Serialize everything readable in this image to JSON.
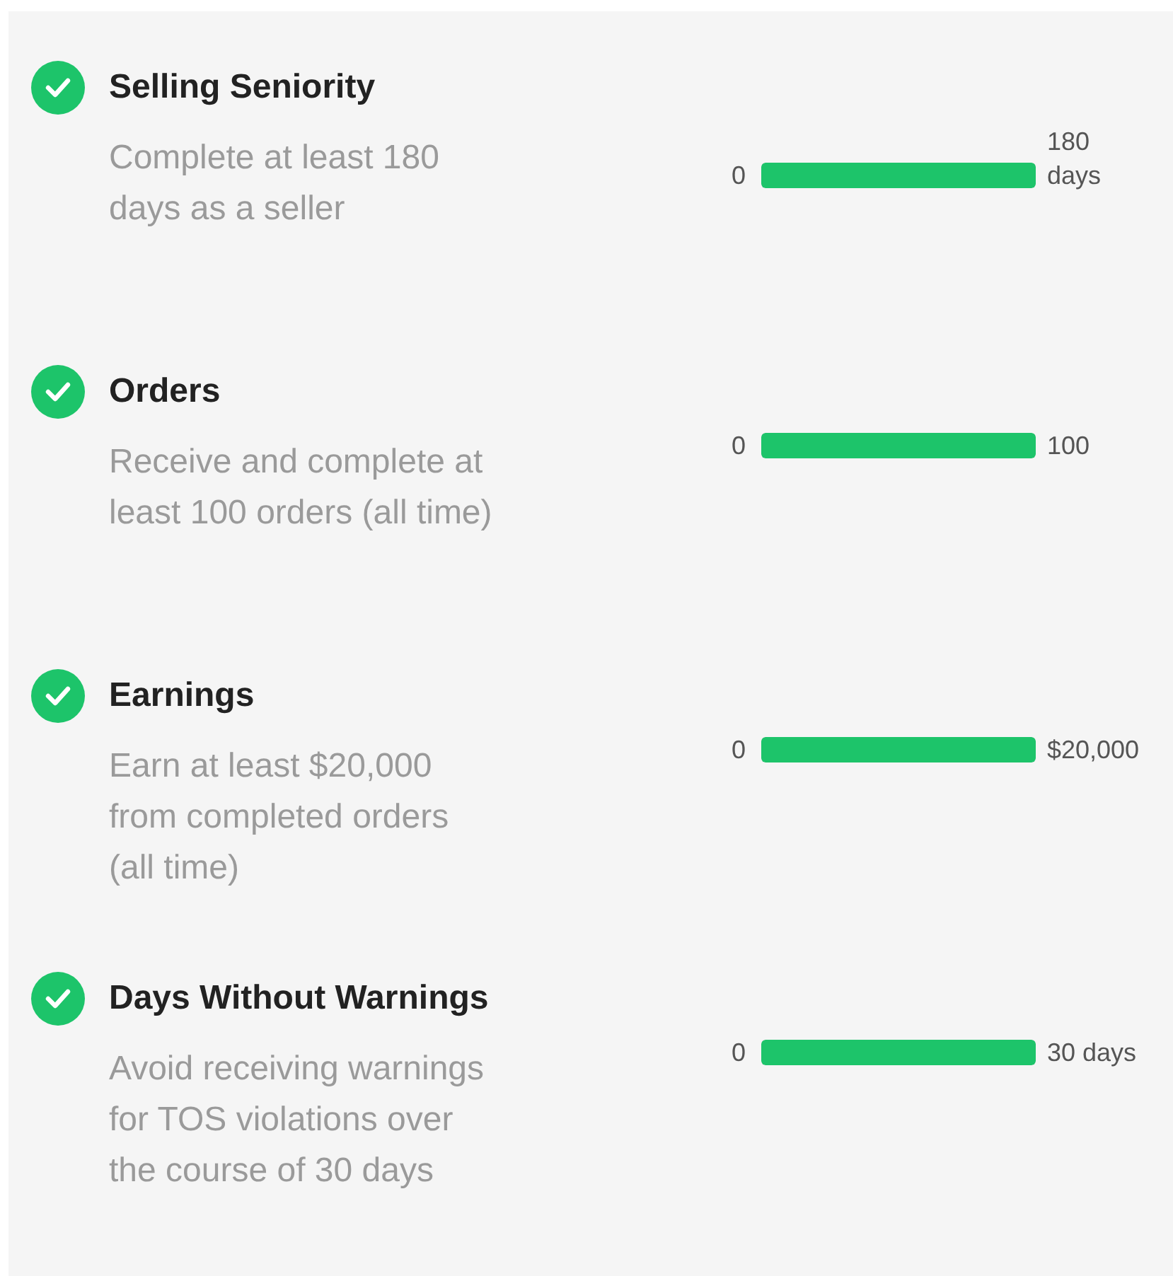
{
  "requirements": [
    {
      "title": "Selling Seniority",
      "description": "Complete at least 180 days as a seller",
      "completed": true,
      "min_label": "0",
      "max_label": "180 days",
      "level": 1
    },
    {
      "title": "Orders",
      "description": "Receive and complete at least 100 orders (all time)",
      "completed": true,
      "min_label": "0",
      "max_label": "100",
      "level": 1
    },
    {
      "title": "Earnings",
      "description": "Earn at least $20,000 from completed orders (all time)",
      "completed": true,
      "min_label": "0",
      "max_label": "$20,000",
      "level": 1
    },
    {
      "title": "Days Without Warnings",
      "description": "Avoid receiving warnings for TOS violations over the course of 30 days",
      "completed": true,
      "min_label": "0",
      "max_label": "30 days",
      "level": 1
    }
  ]
}
